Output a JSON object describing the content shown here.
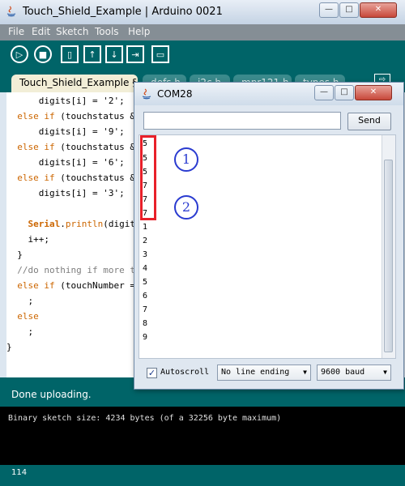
{
  "main_window": {
    "title": "Touch_Shield_Example | Arduino 0021",
    "controls": {
      "minimize": "—",
      "maximize": "□",
      "close": "✕"
    }
  },
  "menu": [
    "File",
    "Edit",
    "Sketch",
    "Tools",
    "Help"
  ],
  "toolbar": {
    "icons": [
      "run-icon",
      "stop-icon",
      "new-icon",
      "open-icon",
      "save-icon",
      "upload-icon",
      "serial-monitor-icon"
    ]
  },
  "tabs": {
    "active": "Touch_Shield_Example §",
    "others": [
      "defs.h",
      "i2c.h",
      "mpr121.h",
      "types.h"
    ]
  },
  "code": {
    "lines": [
      "      digits[i] = '2';",
      "    else if (touchstatus &",
      "      digits[i] = '9';",
      "    else if (touchstatus &",
      "      digits[i] = '6';",
      "    else if (touchstatus &",
      "      digits[i] = '3';",
      "",
      "    Serial.println(digit",
      "    i++;",
      "  }",
      "  //do nothing if more th",
      "  else if (touchNumber ==",
      "    ;",
      "  else",
      "    ;",
      "}"
    ]
  },
  "status": {
    "message": "Done uploading."
  },
  "console": {
    "text": "Binary sketch size: 4234 bytes (of a 32256 byte maximum)"
  },
  "footer": {
    "line_number": "114"
  },
  "serial_monitor": {
    "title": "COM28",
    "input_value": "",
    "send_label": "Send",
    "output": [
      "5",
      "5",
      "5",
      "7",
      "7",
      "7",
      "1",
      "2",
      "3",
      "4",
      "5",
      "6",
      "7",
      "8",
      "9"
    ],
    "annotations": [
      "1",
      "2"
    ],
    "autoscroll_label": "Autoscroll",
    "autoscroll_checked": true,
    "line_ending": "No line ending",
    "baud": "9600 baud"
  },
  "colors": {
    "toolbar": "#006468",
    "highlight_box": "#e8202a",
    "annotation": "#2a3bd0"
  }
}
